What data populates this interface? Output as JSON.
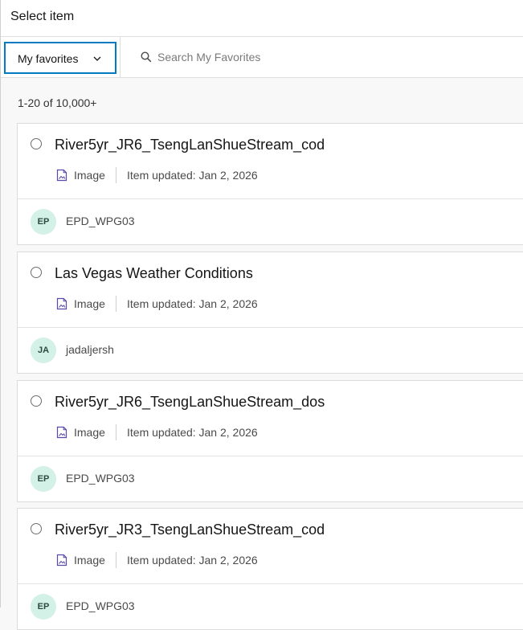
{
  "header": {
    "title": "Select item"
  },
  "toolbar": {
    "dropdown_label": "My favorites",
    "search_placeholder": "Search My Favorites"
  },
  "results": {
    "count_text": "1-20 of 10,000+"
  },
  "icons": {
    "chevron": "chevron-down-icon",
    "search": "search-icon",
    "item_type": "image-icon"
  },
  "colors": {
    "accent": "#007ac2",
    "item_type_icon": "#5b49a8",
    "avatar_bg": "#d3f1e6"
  },
  "items": [
    {
      "title": "River5yr_JR6_TsengLanShueStream_cod",
      "type": "Image",
      "updated": "Item updated: Jan 2, 2026",
      "owner_initials": "EP",
      "owner": "EPD_WPG03"
    },
    {
      "title": "Las Vegas Weather Conditions",
      "type": "Image",
      "updated": "Item updated: Jan 2, 2026",
      "owner_initials": "JA",
      "owner": "jadaljersh"
    },
    {
      "title": "River5yr_JR6_TsengLanShueStream_dos",
      "type": "Image",
      "updated": "Item updated: Jan 2, 2026",
      "owner_initials": "EP",
      "owner": "EPD_WPG03"
    },
    {
      "title": "River5yr_JR3_TsengLanShueStream_cod",
      "type": "Image",
      "updated": "Item updated: Jan 2, 2026",
      "owner_initials": "EP",
      "owner": "EPD_WPG03"
    }
  ]
}
